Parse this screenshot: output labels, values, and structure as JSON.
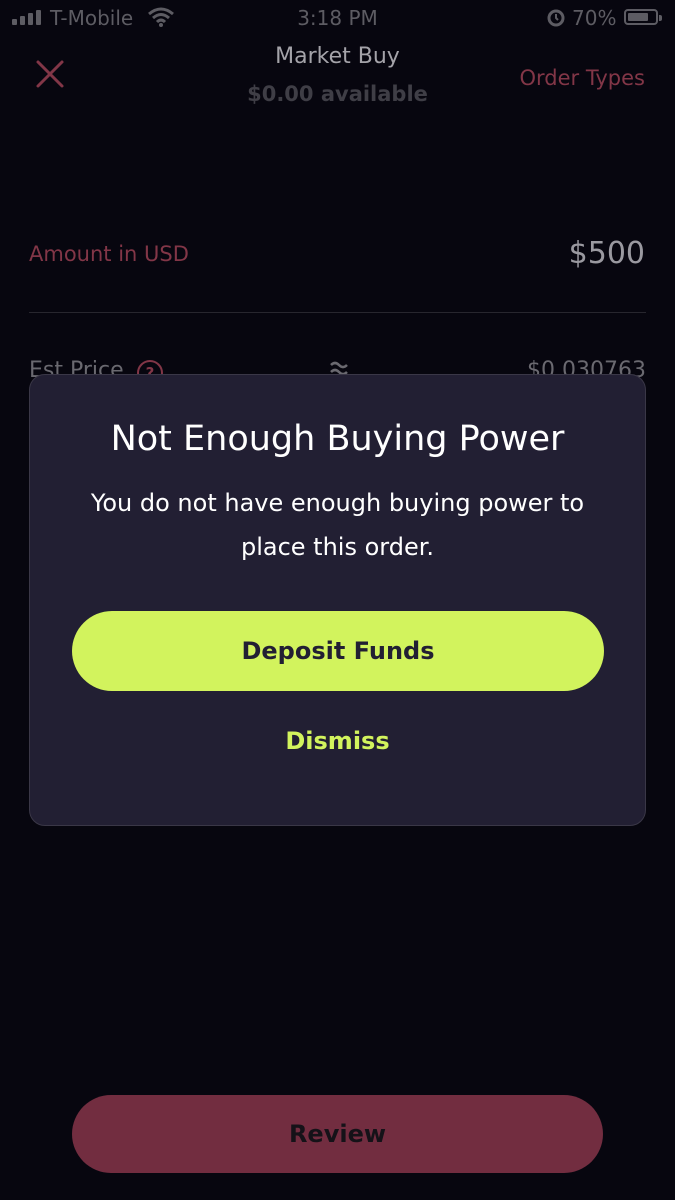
{
  "status_bar": {
    "carrier": "T-Mobile",
    "time": "3:18 PM",
    "battery_percent": "70%"
  },
  "header": {
    "title": "Market Buy",
    "subtitle": "$0.00 available",
    "order_types_label": "Order Types"
  },
  "amount": {
    "label": "Amount in USD",
    "value": "$500"
  },
  "est_price": {
    "label": "Est Price",
    "help_icon": "?",
    "value": "$0.030763"
  },
  "modal": {
    "title": "Not Enough Buying Power",
    "message": "You do not have enough buying power to place this order.",
    "primary_button": "Deposit Funds",
    "secondary_button": "Dismiss"
  },
  "footer": {
    "review_label": "Review"
  },
  "colors": {
    "background": "#07060f",
    "modal_background": "#221f33",
    "accent_lime": "#d2f35d",
    "accent_maroon": "#722d40",
    "muted_rose_text": "#823647"
  },
  "icons": {
    "close": "close-icon",
    "help": "question-circle-icon",
    "approx": "approximately-equal-icon",
    "wifi": "wifi-icon",
    "alarm": "alarm-icon",
    "battery": "battery-icon"
  }
}
